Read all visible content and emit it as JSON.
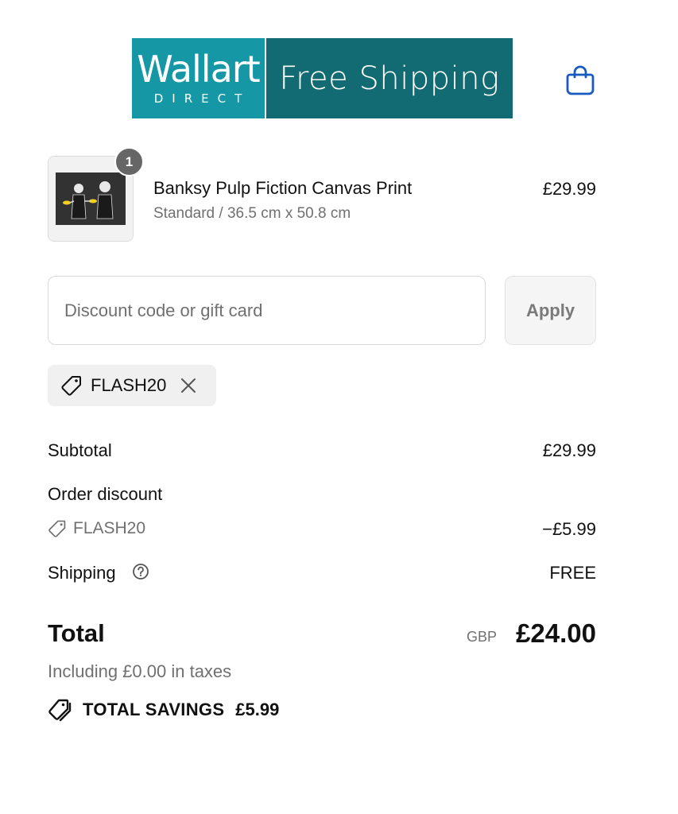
{
  "header": {
    "logo_main": "Wallart",
    "logo_sub": "DIRECT",
    "banner_text": "Free Shipping",
    "cart_icon": "shopping-bag-icon",
    "colors": {
      "logo_bg": "#1697a5",
      "banner_bg": "#126b72",
      "cart_icon": "#1a5bbf"
    }
  },
  "line_item": {
    "quantity": "1",
    "title": "Banksy Pulp Fiction Canvas Print",
    "variant": "Standard / 36.5 cm x 50.8 cm",
    "price": "£29.99"
  },
  "discount": {
    "placeholder": "Discount code or gift card",
    "value": "",
    "apply_label": "Apply",
    "applied_code": "FLASH20",
    "remove_icon": "close-icon",
    "tag_icon": "tag-icon"
  },
  "summary": {
    "subtotal_label": "Subtotal",
    "subtotal_value": "£29.99",
    "order_discount_label": "Order discount",
    "discount_code": "FLASH20",
    "discount_value": "−£5.99",
    "shipping_label": "Shipping",
    "shipping_value": "FREE",
    "help_icon": "question-circle-icon"
  },
  "total": {
    "label": "Total",
    "currency": "GBP",
    "value": "£24.00",
    "tax_note": "Including £0.00 in taxes",
    "savings_label": "TOTAL SAVINGS",
    "savings_value": "£5.99"
  }
}
